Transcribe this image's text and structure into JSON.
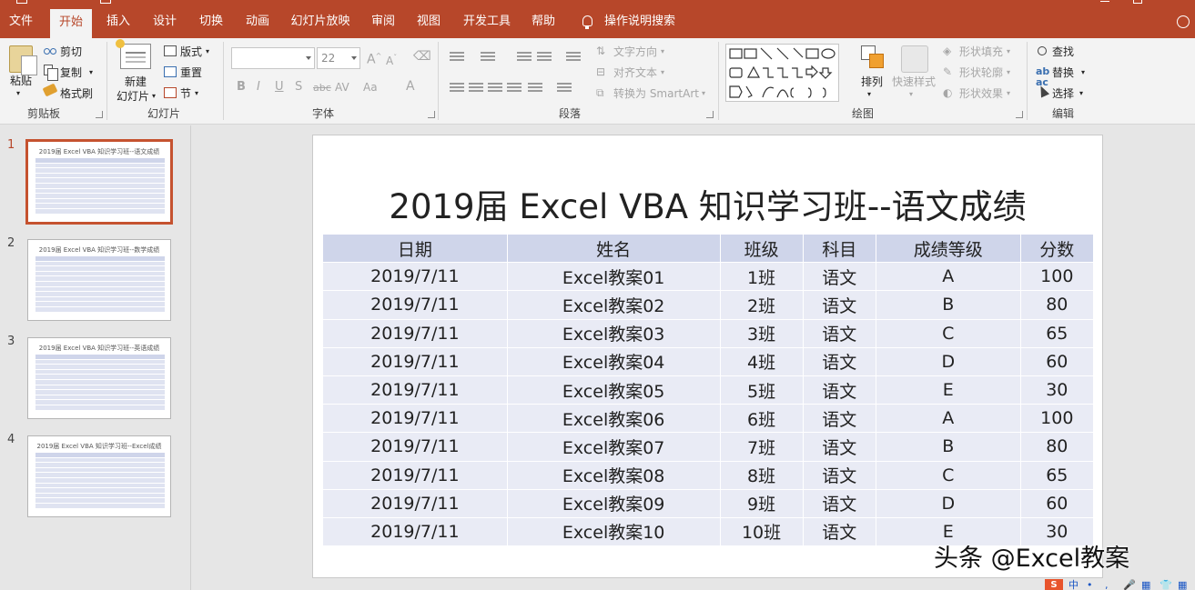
{
  "ribbon_tabs": [
    {
      "label": "文件",
      "active": false
    },
    {
      "label": "开始",
      "active": true
    },
    {
      "label": "插入",
      "active": false
    },
    {
      "label": "设计",
      "active": false
    },
    {
      "label": "切换",
      "active": false
    },
    {
      "label": "动画",
      "active": false
    },
    {
      "label": "幻灯片放映",
      "active": false
    },
    {
      "label": "审阅",
      "active": false
    },
    {
      "label": "视图",
      "active": false
    },
    {
      "label": "开发工具",
      "active": false
    },
    {
      "label": "帮助",
      "active": false
    }
  ],
  "tell_me": "操作说明搜索",
  "ribbon": {
    "clipboard": {
      "group": "剪贴板",
      "paste": "粘贴",
      "cut": "剪切",
      "copy": "复制",
      "format_painter": "格式刷"
    },
    "slides": {
      "group": "幻灯片",
      "new_slide_1": "新建",
      "new_slide_2": "幻灯片",
      "layout": "版式",
      "reset": "重置",
      "section": "节"
    },
    "font": {
      "group": "字体",
      "font_name": "",
      "font_size": "22",
      "bold": "B",
      "italic": "I",
      "underline": "U",
      "shadow": "S",
      "strike": "abc",
      "spacing": "AV",
      "case": "Aa",
      "color": "A"
    },
    "paragraph": {
      "group": "段落",
      "text_direction": "文字方向",
      "align_text": "对齐文本",
      "smartart": "转换为 SmartArt"
    },
    "drawing": {
      "group": "绘图",
      "arrange": "排列",
      "quick_styles": "快速样式",
      "shape_fill": "形状填充",
      "shape_outline": "形状轮廓",
      "shape_effects": "形状效果"
    },
    "editing": {
      "group": "编辑",
      "find": "查找",
      "replace": "替换",
      "select": "选择"
    }
  },
  "thumbnails": [
    {
      "num": "1",
      "title": "2019届 Excel VBA 知识学习班--语文成绩",
      "selected": true
    },
    {
      "num": "2",
      "title": "2019届 Excel VBA 知识学习班--数学成绩",
      "selected": false
    },
    {
      "num": "3",
      "title": "2019届 Excel VBA 知识学习班--英语成绩",
      "selected": false
    },
    {
      "num": "4",
      "title": "2019届 Excel VBA 知识学习班--Excel成绩",
      "selected": false
    }
  ],
  "slide": {
    "title": "2019届 Excel VBA 知识学习班--语文成绩",
    "headers": [
      "日期",
      "姓名",
      "班级",
      "科目",
      "成绩等级",
      "分数"
    ],
    "rows": [
      [
        "2019/7/11",
        "Excel教案01",
        "1班",
        "语文",
        "A",
        "100"
      ],
      [
        "2019/7/11",
        "Excel教案02",
        "2班",
        "语文",
        "B",
        "80"
      ],
      [
        "2019/7/11",
        "Excel教案03",
        "3班",
        "语文",
        "C",
        "65"
      ],
      [
        "2019/7/11",
        "Excel教案04",
        "4班",
        "语文",
        "D",
        "60"
      ],
      [
        "2019/7/11",
        "Excel教案05",
        "5班",
        "语文",
        "E",
        "30"
      ],
      [
        "2019/7/11",
        "Excel教案06",
        "6班",
        "语文",
        "A",
        "100"
      ],
      [
        "2019/7/11",
        "Excel教案07",
        "7班",
        "语文",
        "B",
        "80"
      ],
      [
        "2019/7/11",
        "Excel教案08",
        "8班",
        "语文",
        "C",
        "65"
      ],
      [
        "2019/7/11",
        "Excel教案09",
        "9班",
        "语文",
        "D",
        "60"
      ],
      [
        "2019/7/11",
        "Excel教案10",
        "10班",
        "语文",
        "E",
        "30"
      ]
    ]
  },
  "watermark": "头条 @Excel教案",
  "ime": {
    "logo": "S",
    "items": [
      "中",
      "•",
      ",",
      "🎤",
      "▦",
      "👕",
      "▦"
    ]
  },
  "colors": {
    "accent": "#b7472a",
    "table_header": "#cfd5ea",
    "table_cell": "#e9ebf5",
    "thumb_selected": "#c5522f"
  }
}
